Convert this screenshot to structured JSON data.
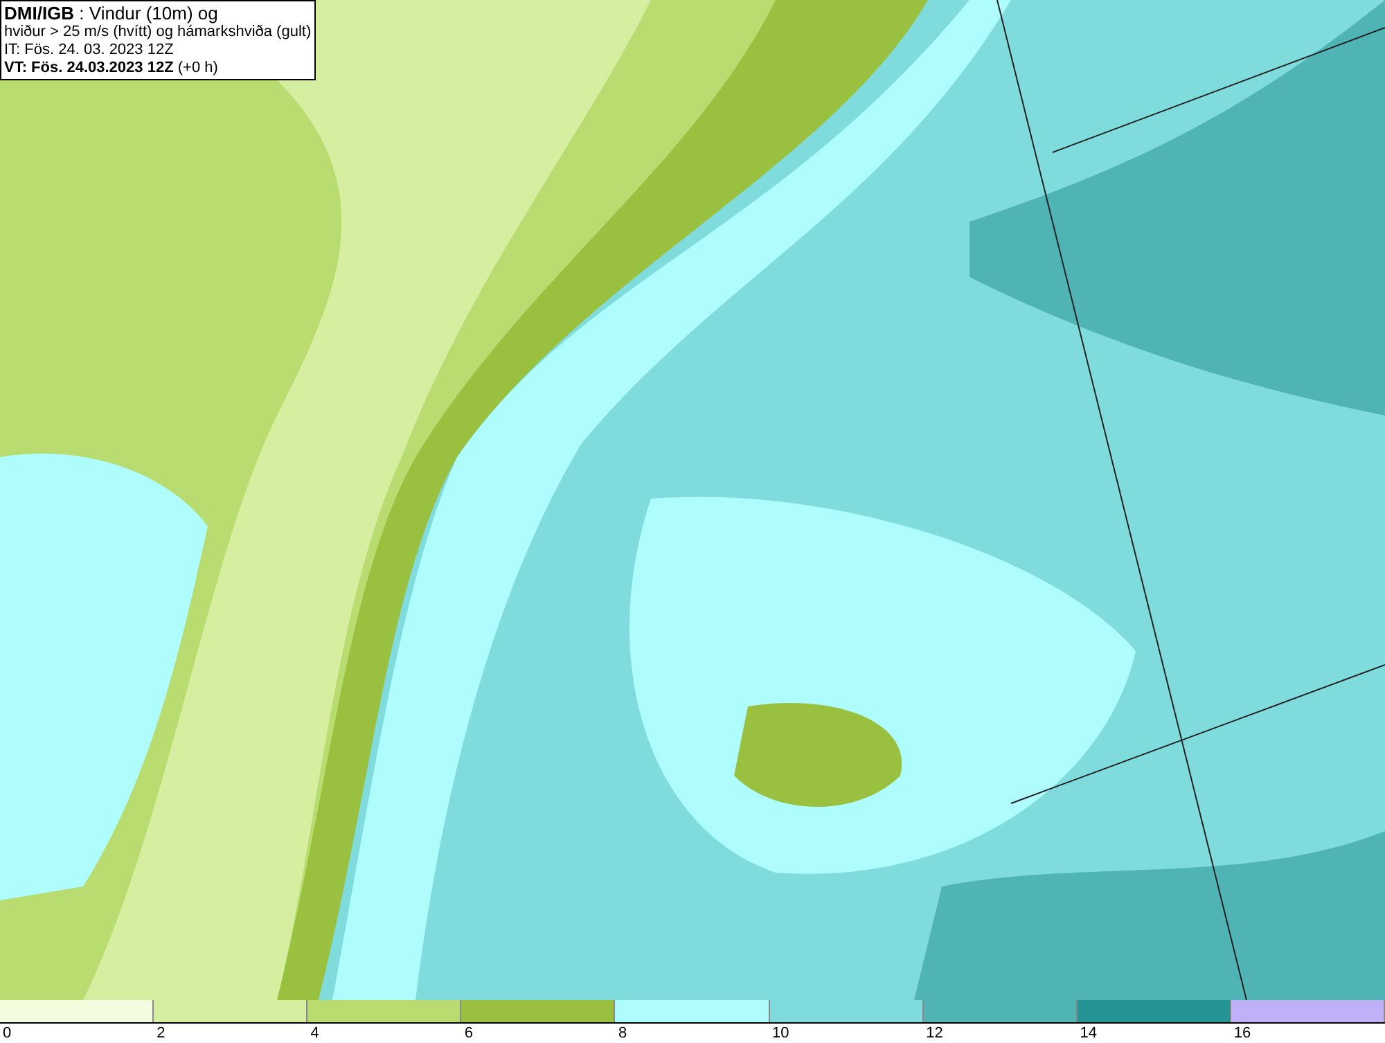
{
  "title_box": {
    "lines": [
      "**DMI/IGB** : Vindur (10m) og",
      "hviður > 25 m/s (hvítt) og hámarkshviða (gult)",
      "IT: Fös. 24. 03. 2023 12Z",
      "**VT: Fös. 24.03.2023 12Z** (+0 h)"
    ]
  },
  "legend": {
    "bins": [
      {
        "color": "#f4fce0"
      },
      {
        "color": "#d6eea0"
      },
      {
        "color": "#b8dc70"
      },
      {
        "color": "#9ac040"
      },
      {
        "color": "#aefcfc"
      },
      {
        "color": "#80dcdc"
      },
      {
        "color": "#50b4b4"
      },
      {
        "color": "#249494"
      },
      {
        "color": "#c0b0f8"
      }
    ],
    "ticks": [
      "0",
      "2",
      "4",
      "6",
      "8",
      "10",
      "12",
      "14",
      "16"
    ]
  }
}
